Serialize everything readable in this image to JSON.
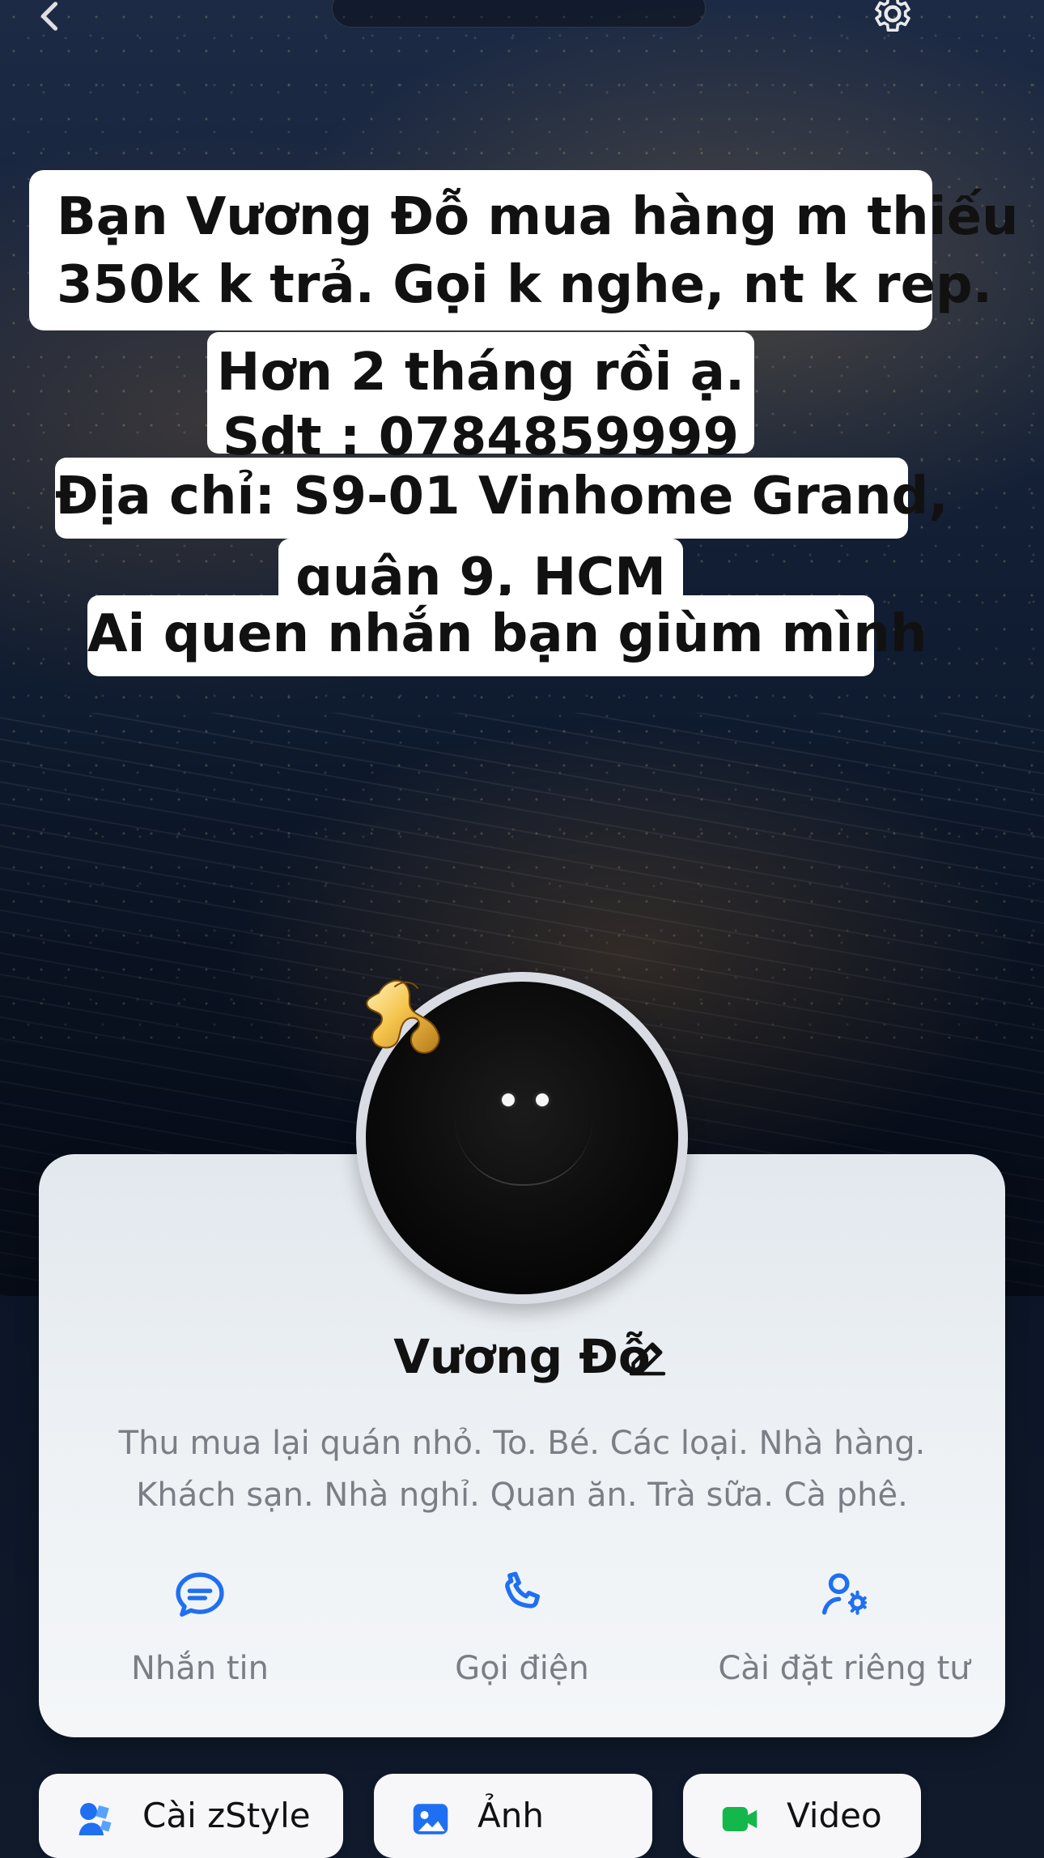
{
  "notice": {
    "line1": "Bạn Vương Đỗ mua hàng m thiếu",
    "line2": "350k k trả. Gọi k nghe, nt k rep.",
    "line3": "Hơn 2 tháng rồi ạ.",
    "line4": "Sdt : 0784859999",
    "line5": "Địa chỉ: S9-01 Vinhome Grand,",
    "line6": "quận 9, HCM",
    "line7": "Ai quen nhắn bạn giùm mình"
  },
  "profile": {
    "name": "Vương Đỗ",
    "bio_line1": "Thu mua lại quán nhỏ. To. Bé. Các loại. Nhà hàng.",
    "bio_line2": "Khách sạn. Nhà nghỉ. Quan ăn. Trà sữa. Cà phê."
  },
  "actions": [
    {
      "label": "Nhắn tin",
      "icon": "chat-bubble-icon"
    },
    {
      "label": "Gọi điện",
      "icon": "phone-icon"
    },
    {
      "label": "Cài đặt riêng tư",
      "icon": "user-gear-icon"
    }
  ],
  "bottom_buttons": [
    {
      "label": "Cài zStyle",
      "icon": "zstyle-icon"
    },
    {
      "label": "Ảnh",
      "icon": "photo-icon"
    },
    {
      "label": "Video",
      "icon": "video-icon"
    }
  ],
  "colors": {
    "accent_blue": "#1f6ff2",
    "card_bg": "#eef2f5",
    "text_primary": "#111111",
    "text_secondary": "#7a7f86",
    "video_green": "#14b84a"
  }
}
